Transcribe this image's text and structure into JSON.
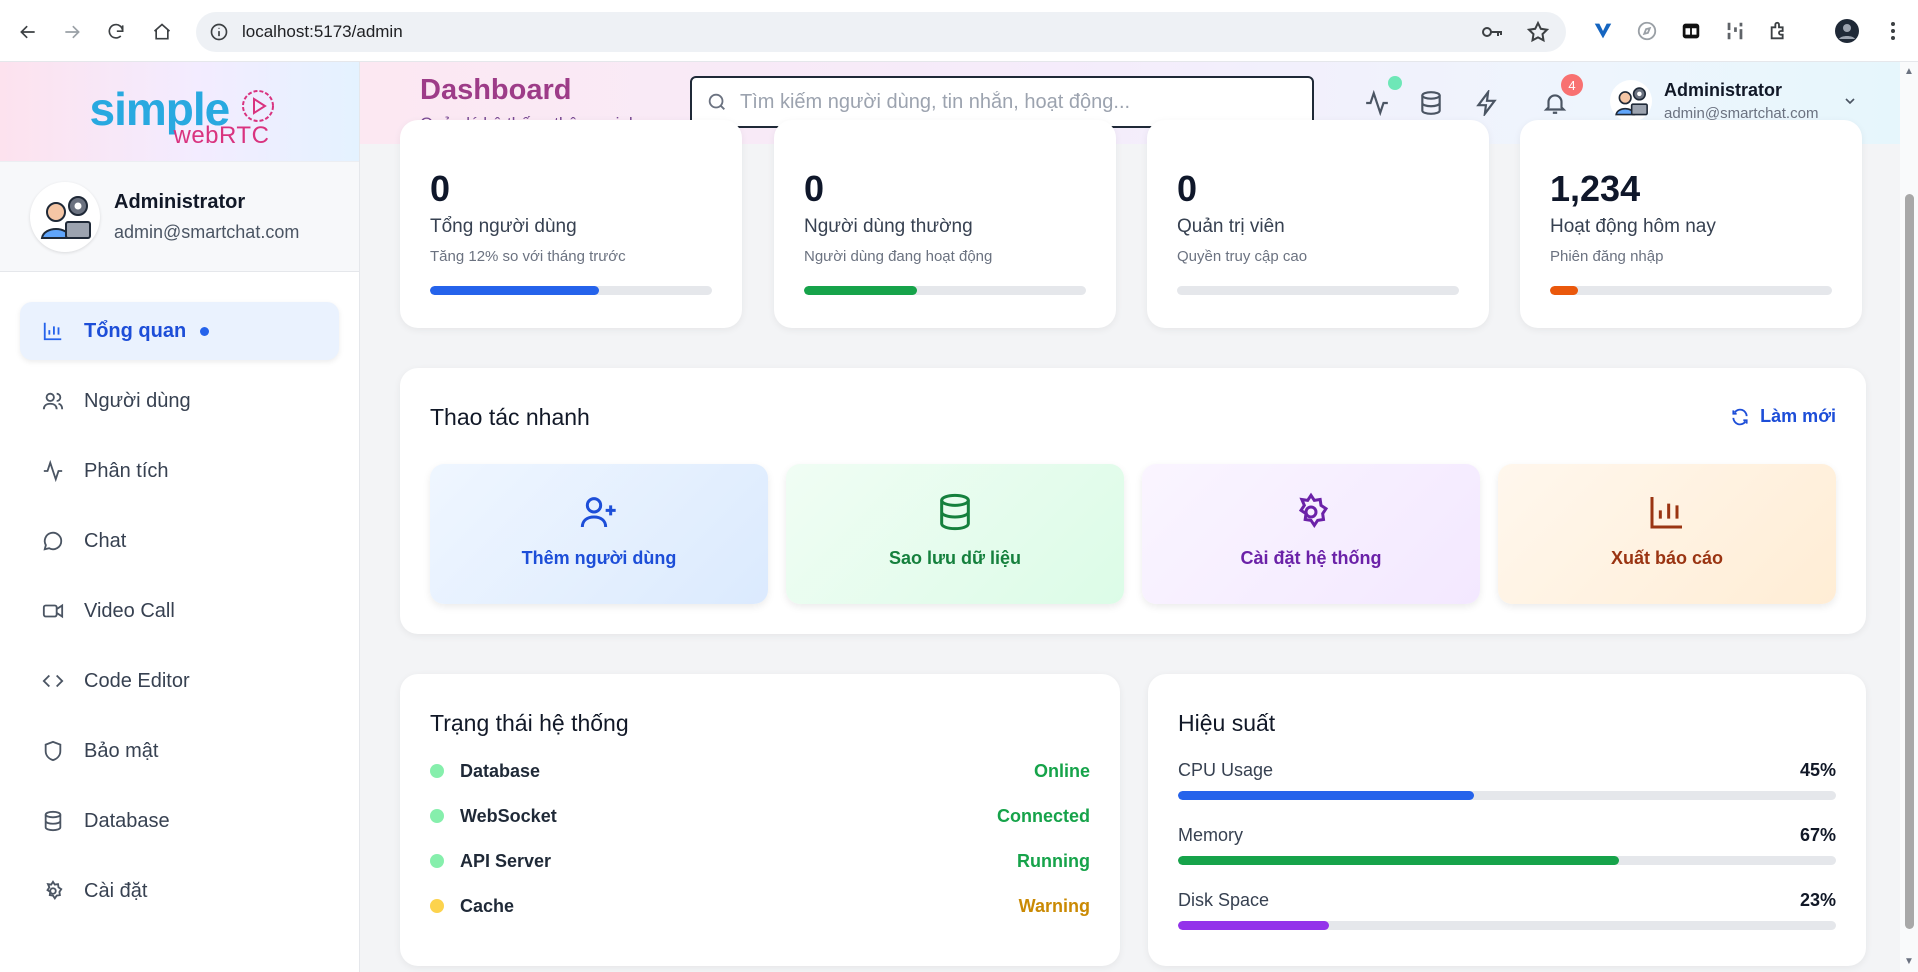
{
  "browser": {
    "url": "localhost:5173/admin"
  },
  "brand": {
    "line1": "simple",
    "line2": "webRTC"
  },
  "sidebar": {
    "profile": {
      "name": "Administrator",
      "email": "admin@smartchat.com"
    },
    "items": [
      {
        "label": "Tổng quan",
        "icon": "bar-chart-icon",
        "active": true
      },
      {
        "label": "Người dùng",
        "icon": "users-icon"
      },
      {
        "label": "Phân tích",
        "icon": "activity-icon"
      },
      {
        "label": "Chat",
        "icon": "message-circle-icon"
      },
      {
        "label": "Video Call",
        "icon": "video-icon"
      },
      {
        "label": "Code Editor",
        "icon": "code-icon"
      },
      {
        "label": "Bảo mật",
        "icon": "shield-icon"
      },
      {
        "label": "Database",
        "icon": "database-icon"
      },
      {
        "label": "Cài đặt",
        "icon": "gear-icon"
      }
    ]
  },
  "header": {
    "title": "Dashboard",
    "subtitle": "Quản lý hệ thống thông minh",
    "search_placeholder": "Tìm kiếm người dùng, tin nhắn, hoạt động...",
    "notification_count": "4",
    "user": {
      "name": "Administrator",
      "email": "admin@smartchat.com"
    }
  },
  "stats": [
    {
      "value": "0",
      "label": "Tổng người dùng",
      "sub": "Tăng 12% so với tháng trước",
      "progress": 0.6,
      "color": "#2563eb"
    },
    {
      "value": "0",
      "label": "Người dùng thường",
      "sub": "Người dùng đang hoạt động",
      "progress": 0.4,
      "color": "#16a34a"
    },
    {
      "value": "0",
      "label": "Quản trị viên",
      "sub": "Quyền truy cập cao",
      "progress": 0,
      "color": "#7c3aed"
    },
    {
      "value": "1,234",
      "label": "Hoạt động hôm nay",
      "sub": "Phiên đăng nhập",
      "progress": 0.1,
      "color": "#ea580c"
    }
  ],
  "quick_actions": {
    "title": "Thao tác nhanh",
    "refresh_label": "Làm mới",
    "tiles": [
      {
        "label": "Thêm người dùng",
        "icon": "user-plus-icon",
        "color": "#1d4ed8",
        "bg": "linear-gradient(135deg,#eff6ff,#dbeafe)"
      },
      {
        "label": "Sao lưu dữ liệu",
        "icon": "database-icon",
        "color": "#15803d",
        "bg": "linear-gradient(135deg,#f0fdf4,#dcfce7)"
      },
      {
        "label": "Cài đặt hệ thống",
        "icon": "gear-icon",
        "color": "#6b21a8",
        "bg": "linear-gradient(135deg,#faf5ff,#f3e8ff)"
      },
      {
        "label": "Xuất báo cáo",
        "icon": "bar-chart-icon",
        "color": "#9a3412",
        "bg": "linear-gradient(135deg,#fff7ed,#ffedd5)"
      }
    ]
  },
  "system_status": {
    "title": "Trạng thái hệ thống",
    "items": [
      {
        "name": "Database",
        "status": "Online",
        "dot": "#86efac",
        "color": "#16a34a"
      },
      {
        "name": "WebSocket",
        "status": "Connected",
        "dot": "#86efac",
        "color": "#16a34a"
      },
      {
        "name": "API Server",
        "status": "Running",
        "dot": "#86efac",
        "color": "#16a34a"
      },
      {
        "name": "Cache",
        "status": "Warning",
        "dot": "#fcd34d",
        "color": "#ca8a04"
      }
    ]
  },
  "performance": {
    "title": "Hiệu suất",
    "items": [
      {
        "name": "CPU Usage",
        "value": "45%",
        "progress": 0.45,
        "color": "#2563eb"
      },
      {
        "name": "Memory",
        "value": "67%",
        "progress": 0.67,
        "color": "#16a34a"
      },
      {
        "name": "Disk Space",
        "value": "23%",
        "progress": 0.23,
        "color": "#9333ea"
      }
    ]
  }
}
